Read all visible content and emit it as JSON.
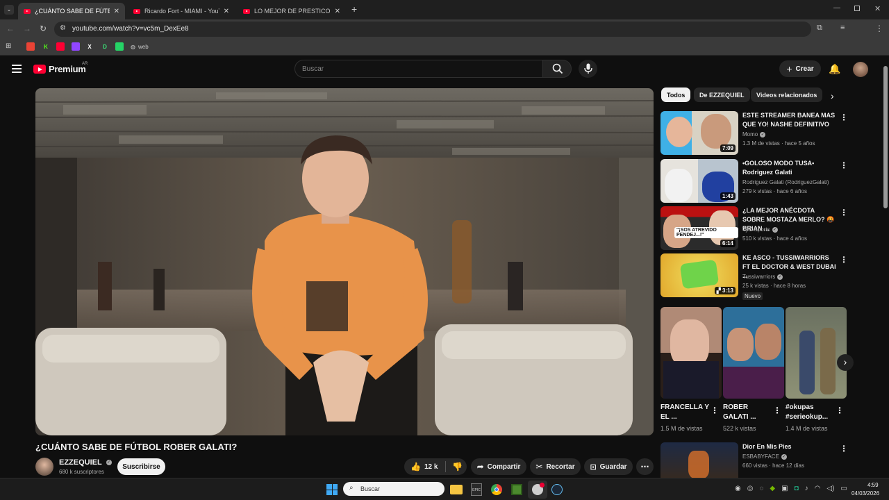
{
  "browser": {
    "tabs": [
      {
        "title": "¿CUÁNTO SABE DE FÚTBOL RO",
        "active": true
      },
      {
        "title": "Ricardo Fort - MIAMI - YouTub",
        "active": false
      },
      {
        "title": "LO MEJOR DE PRESTICO | COM",
        "active": false
      }
    ],
    "url": "youtube.com/watch?v=vc5m_DexEe8",
    "bookmarks": [
      {
        "label": "",
        "icon": "gmail-icon",
        "color": "#ea4335"
      },
      {
        "label": "K",
        "icon": "kick-icon",
        "color": "#53fc18"
      },
      {
        "label": "",
        "icon": "youtube-icon",
        "color": "#ff0033"
      },
      {
        "label": "",
        "icon": "twitch-icon",
        "color": "#9146ff"
      },
      {
        "label": "X",
        "icon": "x-icon",
        "color": "#ffffff"
      },
      {
        "label": "D",
        "icon": "d-icon",
        "color": "#3be477"
      },
      {
        "label": "",
        "icon": "whatsapp-icon",
        "color": "#25d366"
      },
      {
        "label": "web",
        "icon": "globe-icon",
        "color": "#c8c8c8"
      }
    ]
  },
  "youtube": {
    "logo_text": "Premium",
    "logo_region": "AR",
    "search_placeholder": "Buscar",
    "create_label": "Crear"
  },
  "video": {
    "title": "¿CUÁNTO SABE DE FÚTBOL ROBER GALATI?",
    "channel": "EZZEQUIEL",
    "subscribers": "680 k suscriptores",
    "subscribe_label": "Suscribirse",
    "likes": "12 k",
    "share_label": "Compartir",
    "clip_label": "Recortar",
    "save_label": "Guardar"
  },
  "chips": [
    "Todos",
    "De EZZEQUIEL",
    "Videos relacionados"
  ],
  "related": [
    {
      "title": "ESTE STREAMER BANEA MAS QUE YO! NASHE DEFINITIVO",
      "channel": "Momo",
      "verified": true,
      "views": "1.3 M de vistas · hace 5 años",
      "duration": "7:09",
      "badge": ""
    },
    {
      "title": "•GOLOSO MODO TUSA• Rodriguez Galati",
      "channel": "Rodriguez Galati (RodriguezGalati)",
      "verified": false,
      "views": "279 k vistas · hace 6 años",
      "duration": "1:43",
      "badge": ""
    },
    {
      "title": "¿LA MEJOR ANÉCDOTA SOBRE MOSTAZA MERLO? 🤬 BRIAN ...",
      "channel": "TyC Sports",
      "verified": true,
      "views": "510 k vistas · hace 4 años",
      "duration": "6:14",
      "badge": ""
    },
    {
      "title": "KE ASCO - TUSSIWARRIORS FT EL DOCTOR & WEST DUBAI ...",
      "channel": "Tussiwarriors",
      "verified": true,
      "views": "25 k vistas · hace 8 horas",
      "duration": "3:13",
      "badge": "Nuevo"
    }
  ],
  "shorts": [
    {
      "title": "FRANCELLA Y EL ...",
      "views": "1.5 M de vistas"
    },
    {
      "title": "ROBER GALATI ...",
      "views": "522 k vistas"
    },
    {
      "title": "#okupas #serieokup...",
      "views": "1.4 M de vistas"
    }
  ],
  "related_bottom": {
    "title": "Dior En Mis Pies",
    "channel": "ESBABYFACE",
    "verified": true,
    "views": "660 vistas · hace 12 días"
  },
  "taskbar": {
    "search_placeholder": "Buscar",
    "time": "4:59",
    "date": "04/03/2026"
  }
}
